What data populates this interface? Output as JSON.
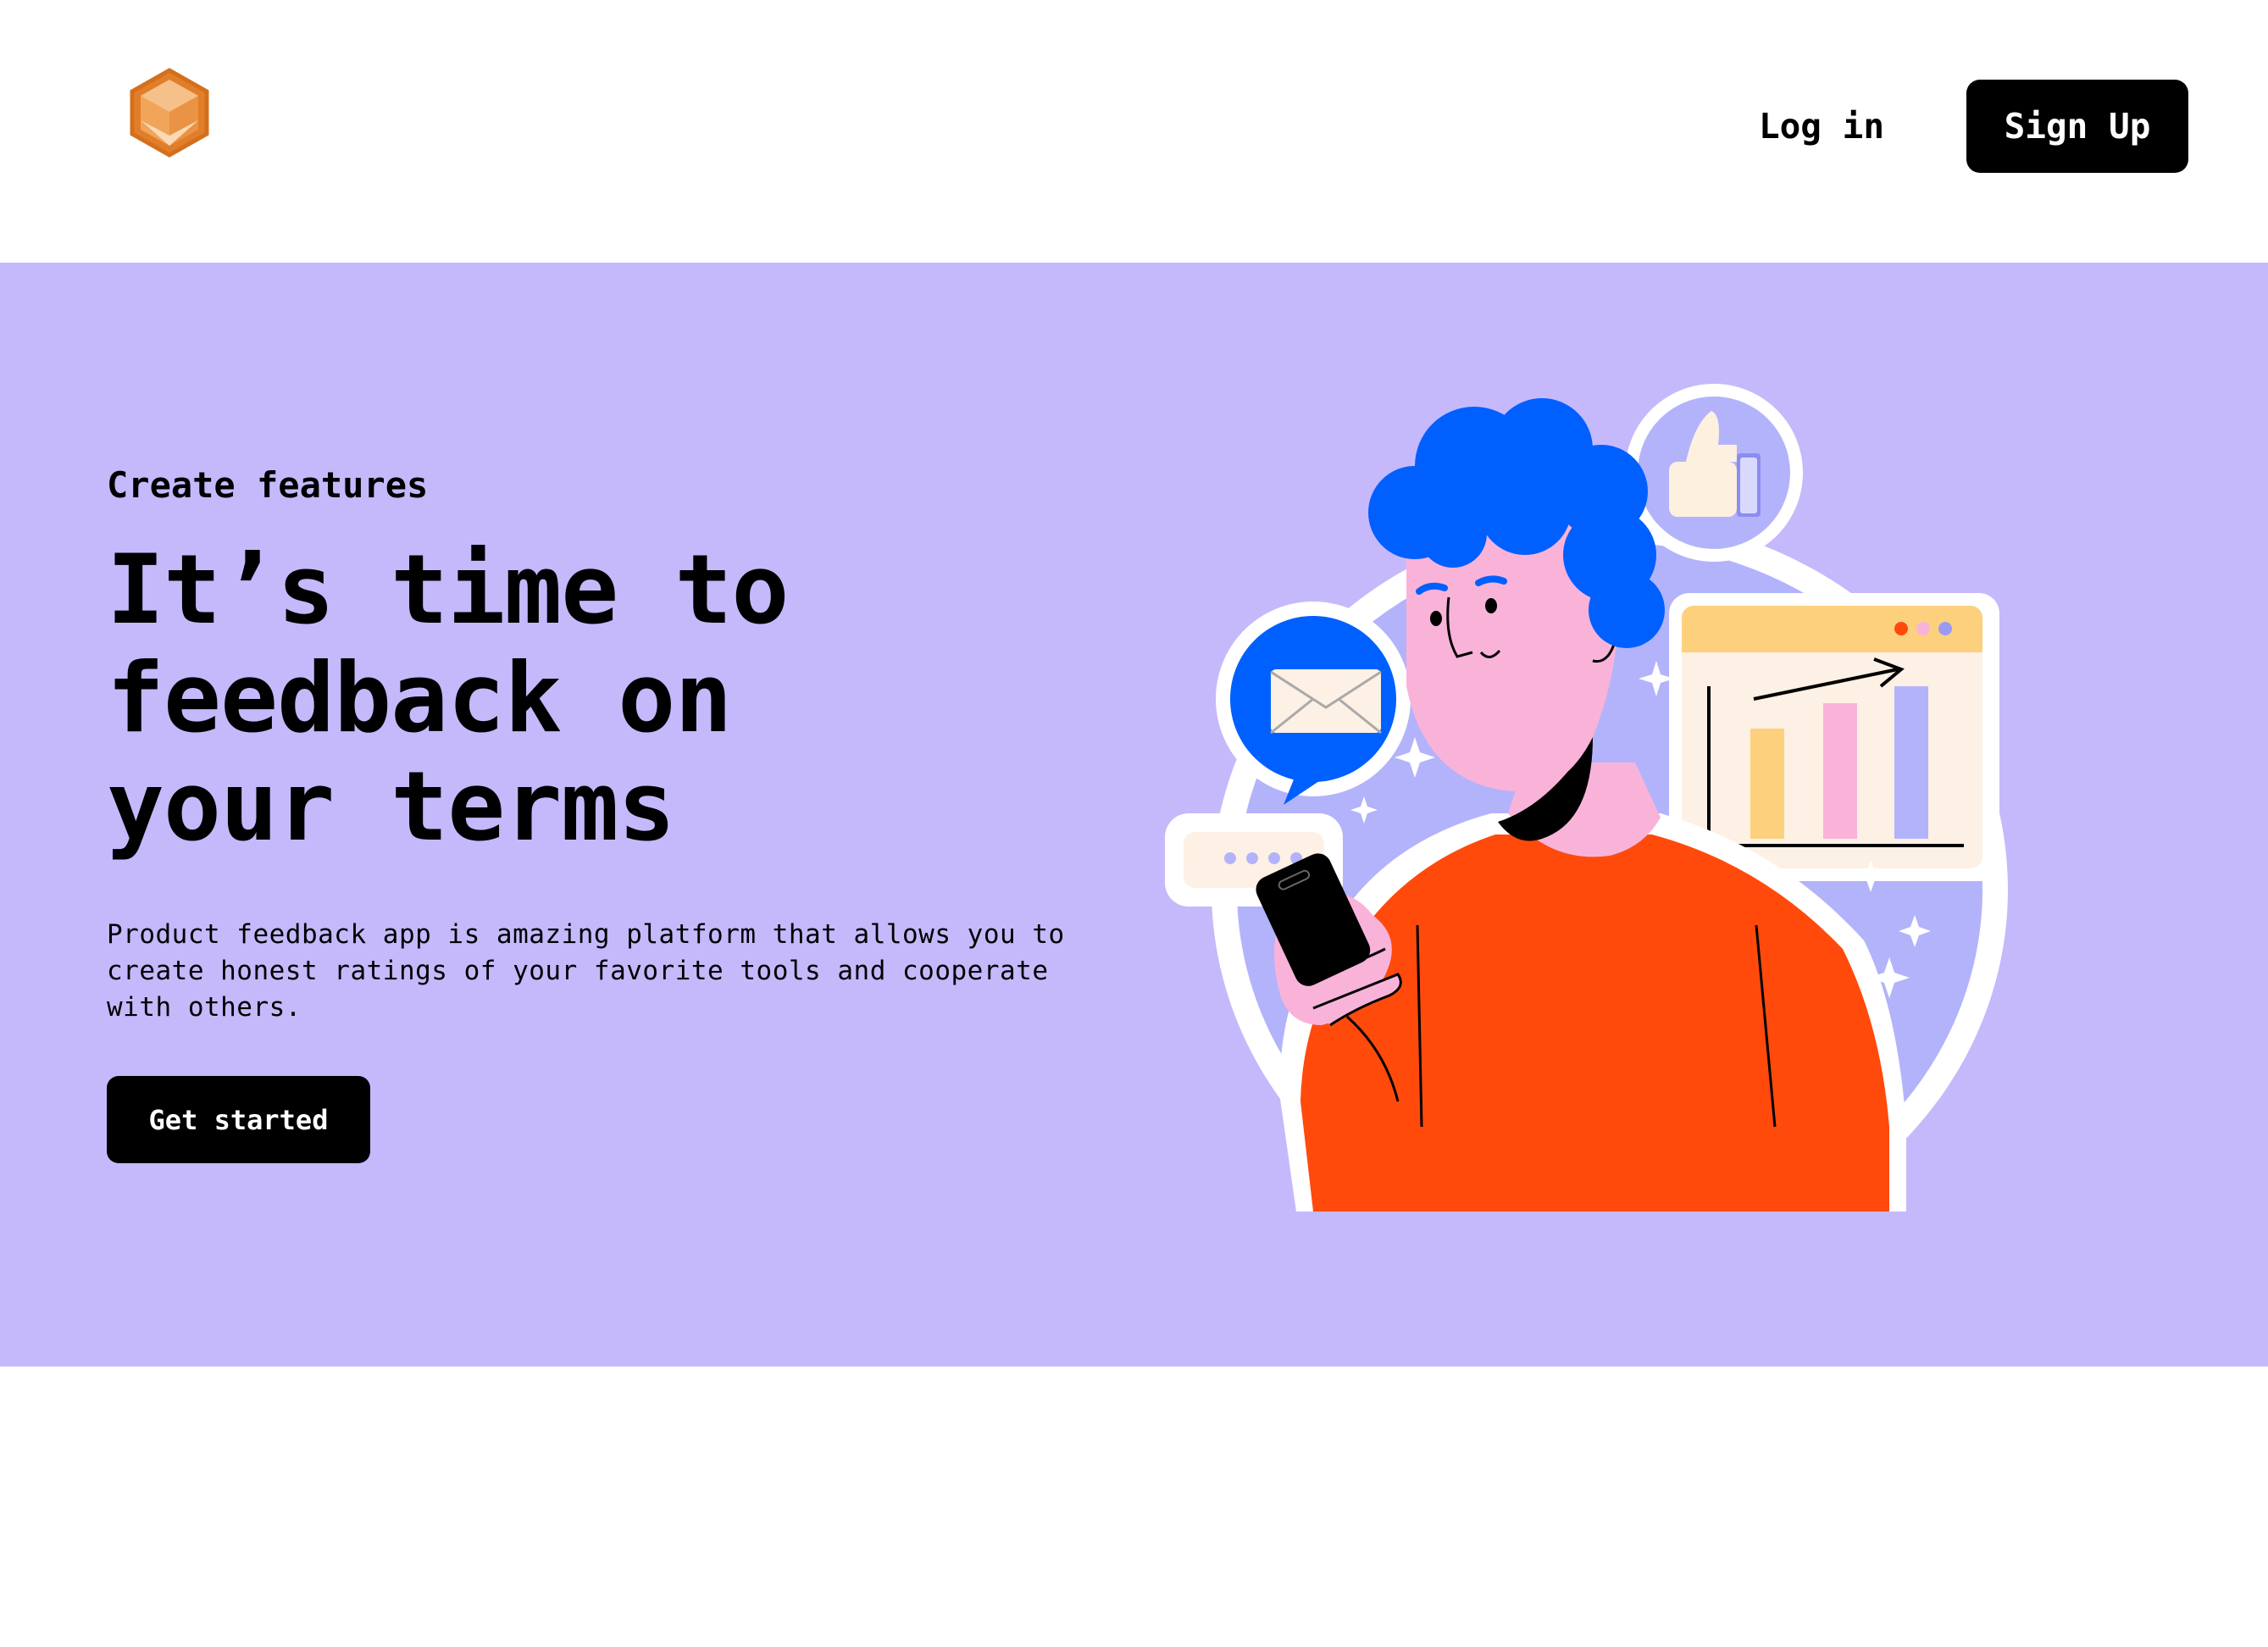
{
  "header": {
    "logo_icon": "hexagon-cube-logo",
    "login_label": "Log in",
    "signup_label": "Sign Up"
  },
  "hero": {
    "eyebrow": "Create features",
    "title": "It’s time to feedback on your terms",
    "description": "Product feedback app is amazing platform that allows you to create honest ratings of your favorite tools and cooperate with others.",
    "cta_label": "Get started",
    "illustration_icons": [
      "person-with-phone-illustration",
      "envelope-icon",
      "thumbs-up-icon",
      "bar-chart-icon",
      "chat-dots-icon",
      "sparkle-icon"
    ]
  },
  "colors": {
    "hero_background": "#c5b9fc",
    "button_background": "#000000",
    "logo_orange": "#e07e2a",
    "sweater_orange": "#ff4a0c",
    "hair_blue": "#0060ff",
    "skin_pink": "#f9b3d9"
  }
}
